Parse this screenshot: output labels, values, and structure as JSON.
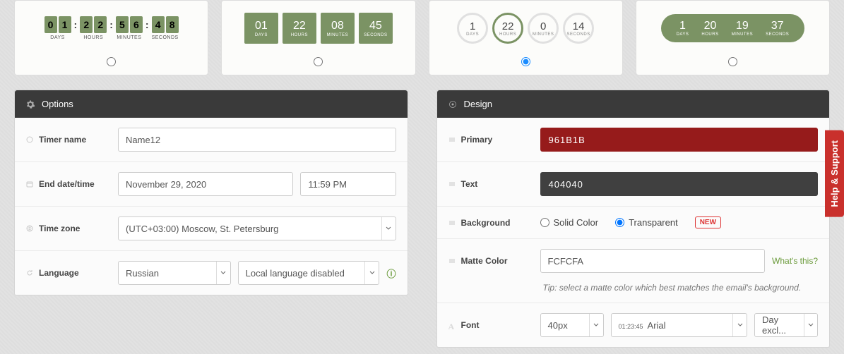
{
  "styles": {
    "s1": {
      "days": [
        "0",
        "1"
      ],
      "hours": [
        "2",
        "2"
      ],
      "minutes": [
        "5",
        "6"
      ],
      "seconds": [
        "4",
        "8"
      ],
      "l_days": "DAYS",
      "l_hours": "HOURS",
      "l_minutes": "MINUTES",
      "l_seconds": "SECONDS"
    },
    "s2": {
      "days": "01",
      "hours": "22",
      "minutes": "08",
      "seconds": "45",
      "l_days": "DAYS",
      "l_hours": "HOURS",
      "l_minutes": "MINUTES",
      "l_seconds": "SECONDS"
    },
    "s3": {
      "days": "1",
      "hours": "22",
      "minutes": "0",
      "seconds": "14",
      "l_days": "DAYS",
      "l_hours": "HOURS",
      "l_minutes": "MINUTES",
      "l_seconds": "SECONDS",
      "selected": true
    },
    "s4": {
      "days": "1",
      "hours": "20",
      "minutes": "19",
      "seconds": "37",
      "l_days": "DAYS",
      "l_hours": "HOURS",
      "l_minutes": "MINUTES",
      "l_seconds": "SECONDS"
    }
  },
  "options": {
    "title": "Options",
    "timer_name_label": "Timer name",
    "timer_name_value": "Name12",
    "end_label": "End date/time",
    "end_date": "November 29, 2020",
    "end_time": "11:59 PM",
    "tz_label": "Time zone",
    "tz_value": "(UTC+03:00) Moscow, St. Petersburg",
    "lang_label": "Language",
    "lang_value": "Russian",
    "lang_local": "Local language disabled"
  },
  "design": {
    "title": "Design",
    "primary_label": "Primary",
    "primary_value": "961B1B",
    "primary_hex": "#961B1B",
    "text_label": "Text",
    "text_value": "404040",
    "text_hex": "#404040",
    "bg_label": "Background",
    "bg_solid": "Solid Color",
    "bg_transparent": "Transparent",
    "bg_new": "NEW",
    "matte_label": "Matte Color",
    "matte_value": "FCFCFA",
    "matte_link": "What's this?",
    "matte_tip": "Tip: select a matte color which best matches the email's background.",
    "font_label": "Font",
    "font_size": "40px",
    "font_sample": "01:23:45",
    "font_family": "Arial",
    "font_day": "Day excl..."
  },
  "help_tab": "Help & Support"
}
